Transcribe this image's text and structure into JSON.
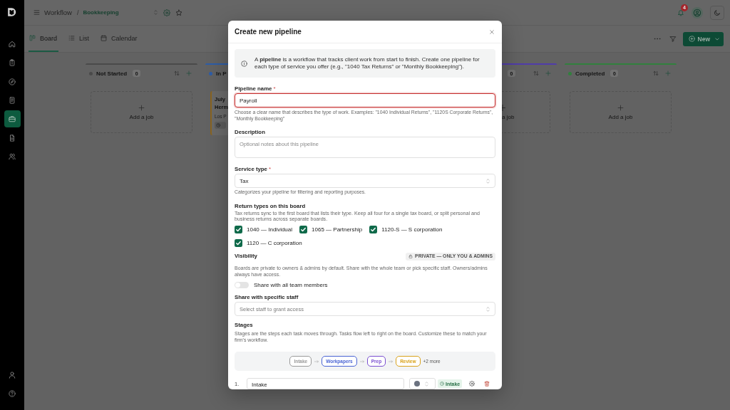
{
  "sidebar": {
    "nav": [
      {
        "kind": "home",
        "selected": false
      },
      {
        "kind": "clipboard",
        "selected": false
      },
      {
        "kind": "compass",
        "selected": false
      },
      {
        "kind": "document",
        "selected": false
      },
      {
        "kind": "briefcase",
        "selected": true
      },
      {
        "kind": "file",
        "selected": false
      },
      {
        "kind": "users",
        "selected": false
      }
    ],
    "footer": [
      {
        "kind": "user"
      },
      {
        "kind": "help"
      }
    ]
  },
  "header": {
    "breadcrumb": {
      "parent": "Workflow",
      "separator": "/",
      "current": "Bookkeeping"
    },
    "notifications": {
      "count": "4"
    }
  },
  "view_tabs": [
    {
      "label": "Board",
      "kind": "board",
      "selected": true
    },
    {
      "label": "List",
      "kind": "list",
      "selected": false
    },
    {
      "label": "Calendar",
      "kind": "calendar",
      "selected": false
    }
  ],
  "new_button": {
    "label": "New"
  },
  "board": {
    "columns": [
      {
        "kind": "full",
        "title": "Not Started",
        "color": "#4a4a4a",
        "count": "0",
        "add_label": "Add a job"
      },
      {
        "kind": "cut_right",
        "title": "In P",
        "color": "#2d5da8",
        "cards": [
          {
            "title_lines": [
              "July",
              "Herm"
            ],
            "client": "Los P"
          }
        ]
      },
      {
        "kind": "cut_left",
        "color": "#503caa",
        "count": "0",
        "add_label": "a job"
      },
      {
        "kind": "full",
        "title": "Completed",
        "color": "#31803d",
        "count": "0",
        "add_label": "Add a job"
      }
    ]
  },
  "dialog": {
    "title": "Create new pipeline",
    "info": "A **pipeline** is a workflow that tracks client work from start to finish. Create one pipeline for each type of service you offer (e.g., \"1040 Tax Returns\" or \"Monthly Bookkeeping\").",
    "pipeline_name": {
      "label": "Pipeline name",
      "required_mark": "*",
      "value": "Payroll",
      "invalid": true,
      "help": "Choose a clear name that describes the type of work. Examples: \"1040 Individual Returns\", \"1120S Corporate Returns\", \"Monthly Bookkeeping\""
    },
    "description": {
      "label": "Description",
      "placeholder": "Optional notes about this pipeline"
    },
    "service_type": {
      "label": "Service type",
      "required_mark": "*",
      "value": "Tax",
      "help": "Categorizes your pipeline for filtering and reporting purposes."
    },
    "return_types": {
      "label": "Return types on this board",
      "help": "Tax returns sync to the first board that lists their type. Keep all four for a single tax board, or split personal and business returns across separate boards.",
      "options": [
        {
          "label": "1040 — Individual",
          "checked": true
        },
        {
          "label": "1065 — Partnership",
          "checked": true
        },
        {
          "label": "1120-S — S corporation",
          "checked": true
        },
        {
          "label": "1120 — C corporation",
          "checked": true
        }
      ]
    },
    "visibility": {
      "label": "Visibility",
      "badge": "PRIVATE — ONLY YOU & ADMINS",
      "help": "Boards are private to owners & admins by default. Share with the whole team or pick specific staff. Owners/admins always have access."
    },
    "share_all": {
      "label": "Share with all team members",
      "on": false
    },
    "share_staff": {
      "label": "Share with specific staff",
      "placeholder": "Select staff to grant access"
    },
    "stages": {
      "label": "Stages",
      "help": "Stages are the steps each task moves through. Tasks flow left to right on the board. Customize these to match your firm's workflow.",
      "preview": {
        "chips": [
          {
            "label": "Intake",
            "color": "#9a9a9a"
          },
          {
            "label": "Workpapers",
            "color": "#4a64d4"
          },
          {
            "label": "Prep",
            "color": "#7a4fd0"
          },
          {
            "label": "Review",
            "color": "#d9a21b"
          }
        ],
        "more": "+2 more"
      },
      "rows": [
        {
          "number": "1.",
          "name": "Intake",
          "color": "#6b7280",
          "tag": "Intake"
        }
      ]
    }
  }
}
